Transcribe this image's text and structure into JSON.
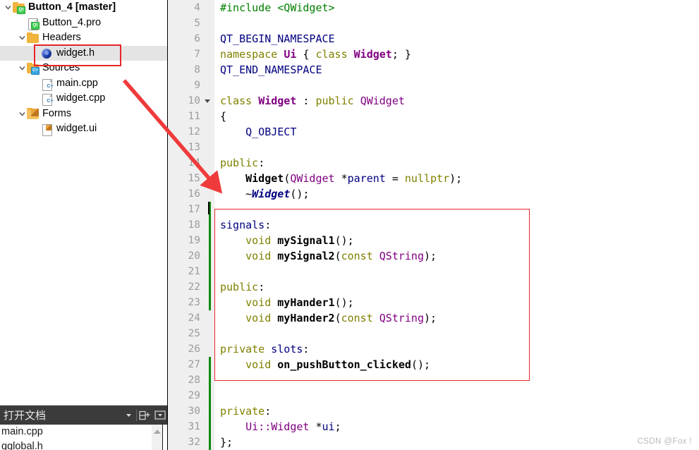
{
  "sidebar": {
    "items": [
      {
        "label": "Button_4 [master]",
        "icon": "qt-project-folder-icon",
        "indent": 0,
        "twisty": "down",
        "bold": true,
        "selected": false,
        "icon_kind": "folder-qt"
      },
      {
        "label": "Button_4.pro",
        "icon": "qt-pro-file-icon",
        "indent": 1,
        "twisty": "none",
        "bold": false,
        "selected": false,
        "icon_kind": "doc-qt"
      },
      {
        "label": "Headers",
        "icon": "folder-icon",
        "indent": 1,
        "twisty": "down",
        "bold": false,
        "selected": false,
        "icon_kind": "folder"
      },
      {
        "label": "widget.h",
        "icon": "header-file-icon",
        "indent": 2,
        "twisty": "none",
        "bold": false,
        "selected": true,
        "icon_kind": "sphere"
      },
      {
        "label": "Sources",
        "icon": "folder-cpp-icon",
        "indent": 1,
        "twisty": "down",
        "bold": false,
        "selected": false,
        "icon_kind": "folder-cpp"
      },
      {
        "label": "main.cpp",
        "icon": "cpp-file-icon",
        "indent": 2,
        "twisty": "none",
        "bold": false,
        "selected": false,
        "icon_kind": "doc-cpp"
      },
      {
        "label": "widget.cpp",
        "icon": "cpp-file-icon",
        "indent": 2,
        "twisty": "none",
        "bold": false,
        "selected": false,
        "icon_kind": "doc-cpp"
      },
      {
        "label": "Forms",
        "icon": "folder-forms-icon",
        "indent": 1,
        "twisty": "down",
        "bold": false,
        "selected": false,
        "icon_kind": "folder-ui"
      },
      {
        "label": "widget.ui",
        "icon": "ui-file-icon",
        "indent": 2,
        "twisty": "none",
        "bold": false,
        "selected": false,
        "icon_kind": "doc-ui"
      }
    ]
  },
  "open_documents": {
    "title": "打开文档",
    "dropdown_icon": "chevron-down-icon",
    "split_icon": "split-pane-add-icon",
    "close_icon": "minimize-pane-icon",
    "items": [
      "main.cpp",
      "qglobal.h"
    ]
  },
  "editor": {
    "first_line": 4,
    "lines": [
      {
        "n": 4,
        "fold": false,
        "tokens": [
          {
            "t": "#include ",
            "c": "c-pre"
          },
          {
            "t": "<QWidget>",
            "c": "c-str"
          }
        ]
      },
      {
        "n": 5,
        "fold": false,
        "tokens": []
      },
      {
        "n": 6,
        "fold": false,
        "tokens": [
          {
            "t": "QT_BEGIN_NAMESPACE",
            "c": "c-macro"
          }
        ]
      },
      {
        "n": 7,
        "fold": false,
        "tokens": [
          {
            "t": "namespace ",
            "c": "c-kw"
          },
          {
            "t": "Ui",
            "c": "c-typeb"
          },
          {
            "t": " { ",
            "c": "c-op"
          },
          {
            "t": "class ",
            "c": "c-kw"
          },
          {
            "t": "Widget",
            "c": "c-typeb"
          },
          {
            "t": "; }",
            "c": "c-op"
          }
        ]
      },
      {
        "n": 8,
        "fold": false,
        "tokens": [
          {
            "t": "QT_END_NAMESPACE",
            "c": "c-macro"
          }
        ]
      },
      {
        "n": 9,
        "fold": false,
        "tokens": []
      },
      {
        "n": 10,
        "fold": true,
        "tokens": [
          {
            "t": "class ",
            "c": "c-kw"
          },
          {
            "t": "Widget",
            "c": "c-typeb"
          },
          {
            "t": " : ",
            "c": "c-op"
          },
          {
            "t": "public ",
            "c": "c-kw"
          },
          {
            "t": "QWidget",
            "c": "c-type"
          }
        ]
      },
      {
        "n": 11,
        "fold": false,
        "tokens": [
          {
            "t": "{",
            "c": "c-op"
          }
        ]
      },
      {
        "n": 12,
        "fold": false,
        "tokens": [
          {
            "t": "    Q_OBJECT",
            "c": "c-macro"
          }
        ]
      },
      {
        "n": 13,
        "fold": false,
        "tokens": []
      },
      {
        "n": 14,
        "fold": false,
        "tokens": [
          {
            "t": "public",
            "c": "c-kw"
          },
          {
            "t": ":",
            "c": "c-op"
          }
        ]
      },
      {
        "n": 15,
        "fold": false,
        "tokens": [
          {
            "t": "    ",
            "c": "c-op"
          },
          {
            "t": "Widget",
            "c": "c-fn"
          },
          {
            "t": "(",
            "c": "c-op"
          },
          {
            "t": "QWidget",
            "c": "c-type"
          },
          {
            "t": " *",
            "c": "c-op"
          },
          {
            "t": "parent",
            "c": "c-macro"
          },
          {
            "t": " = ",
            "c": "c-op"
          },
          {
            "t": "nullptr",
            "c": "c-kw"
          },
          {
            "t": ");",
            "c": "c-op"
          }
        ]
      },
      {
        "n": 16,
        "fold": false,
        "tokens": [
          {
            "t": "    ~",
            "c": "c-op"
          },
          {
            "t": "Widget",
            "c": "c-fni"
          },
          {
            "t": "();",
            "c": "c-op"
          }
        ]
      },
      {
        "n": 17,
        "fold": false,
        "tokens": []
      },
      {
        "n": 18,
        "fold": false,
        "tokens": [
          {
            "t": "signals",
            "c": "c-macro"
          },
          {
            "t": ":",
            "c": "c-op"
          }
        ]
      },
      {
        "n": 19,
        "fold": false,
        "tokens": [
          {
            "t": "    void ",
            "c": "c-kw"
          },
          {
            "t": "mySignal1",
            "c": "c-fn"
          },
          {
            "t": "();",
            "c": "c-op"
          }
        ]
      },
      {
        "n": 20,
        "fold": false,
        "tokens": [
          {
            "t": "    void ",
            "c": "c-kw"
          },
          {
            "t": "mySignal2",
            "c": "c-fn"
          },
          {
            "t": "(",
            "c": "c-op"
          },
          {
            "t": "const ",
            "c": "c-kw"
          },
          {
            "t": "QString",
            "c": "c-type"
          },
          {
            "t": ");",
            "c": "c-op"
          }
        ]
      },
      {
        "n": 21,
        "fold": false,
        "tokens": []
      },
      {
        "n": 22,
        "fold": false,
        "tokens": [
          {
            "t": "public",
            "c": "c-kw"
          },
          {
            "t": ":",
            "c": "c-op"
          }
        ]
      },
      {
        "n": 23,
        "fold": false,
        "tokens": [
          {
            "t": "    void ",
            "c": "c-kw"
          },
          {
            "t": "myHander1",
            "c": "c-fn"
          },
          {
            "t": "();",
            "c": "c-op"
          }
        ]
      },
      {
        "n": 24,
        "fold": false,
        "tokens": [
          {
            "t": "    void ",
            "c": "c-kw"
          },
          {
            "t": "myHander2",
            "c": "c-fn"
          },
          {
            "t": "(",
            "c": "c-op"
          },
          {
            "t": "const ",
            "c": "c-kw"
          },
          {
            "t": "QString",
            "c": "c-type"
          },
          {
            "t": ");",
            "c": "c-op"
          }
        ]
      },
      {
        "n": 25,
        "fold": false,
        "tokens": []
      },
      {
        "n": 26,
        "fold": false,
        "tokens": [
          {
            "t": "private ",
            "c": "c-kw"
          },
          {
            "t": "slots",
            "c": "c-slots"
          },
          {
            "t": ":",
            "c": "c-op"
          }
        ]
      },
      {
        "n": 27,
        "fold": false,
        "tokens": [
          {
            "t": "    void ",
            "c": "c-kw"
          },
          {
            "t": "on_pushButton_clicked",
            "c": "c-fn"
          },
          {
            "t": "();",
            "c": "c-op"
          }
        ]
      },
      {
        "n": 28,
        "fold": false,
        "tokens": []
      },
      {
        "n": 29,
        "fold": false,
        "tokens": []
      },
      {
        "n": 30,
        "fold": false,
        "tokens": [
          {
            "t": "private",
            "c": "c-kw"
          },
          {
            "t": ":",
            "c": "c-op"
          }
        ]
      },
      {
        "n": 31,
        "fold": false,
        "tokens": [
          {
            "t": "    ",
            "c": "c-op"
          },
          {
            "t": "Ui::Widget",
            "c": "c-type"
          },
          {
            "t": " *",
            "c": "c-op"
          },
          {
            "t": "ui",
            "c": "c-macro"
          },
          {
            "t": ";",
            "c": "c-op"
          }
        ]
      },
      {
        "n": 32,
        "fold": false,
        "tokens": [
          {
            "t": "};",
            "c": "c-op"
          }
        ]
      }
    ]
  },
  "annotations": {
    "highlight_file_label": "widget.h",
    "highlight_block_label": "signals-and-slots-block",
    "arrow_label": "red-pointer-arrow",
    "accent_red": "#e8262a",
    "change_bar_green": "#0c8a0c"
  },
  "watermark": {
    "text": "CSDN @Fox !"
  }
}
